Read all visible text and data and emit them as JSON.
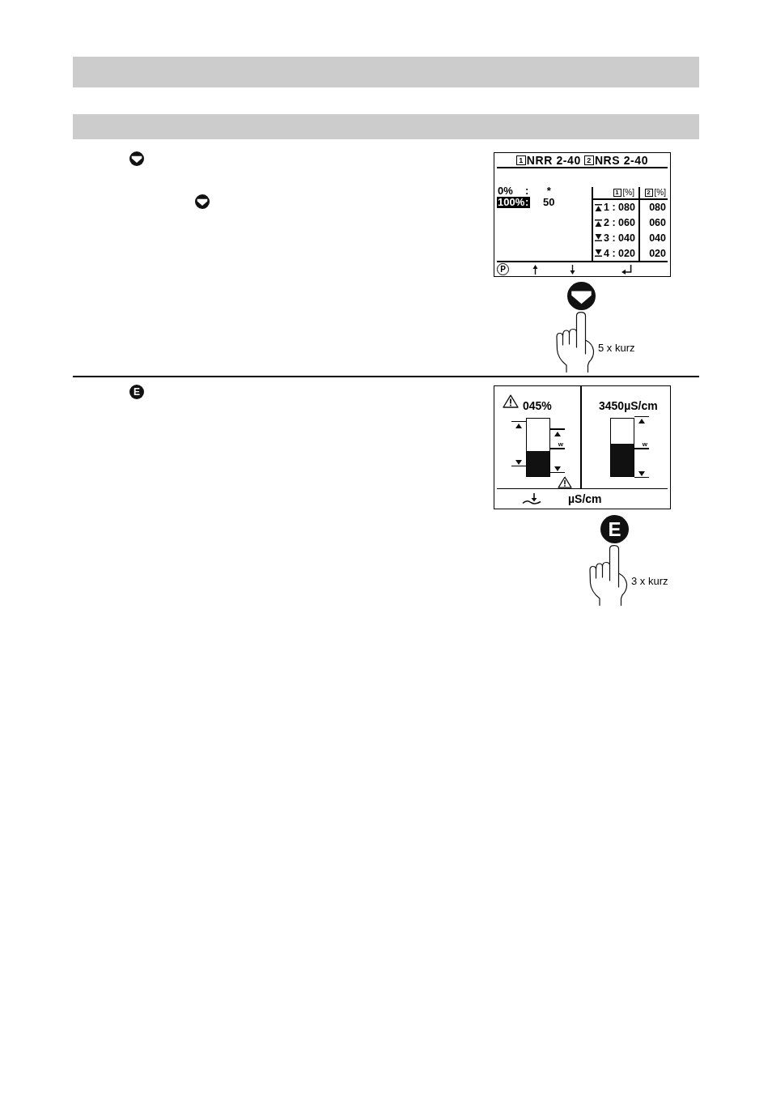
{
  "steps": [
    {
      "keys": [
        {
          "kind": "down"
        },
        {
          "kind": "down"
        }
      ],
      "display": {
        "kind": "scale",
        "title": [
          {
            "number": "1",
            "text": "NRR 2-40"
          },
          {
            "number": "2",
            "text": "NRS 2-40"
          }
        ],
        "scale": [
          {
            "label": "0%",
            "colon": ":",
            "value": "*",
            "selected": false
          },
          {
            "label": "100%",
            "colon": ":",
            "value": "50",
            "selected": true
          }
        ],
        "table": {
          "columns": [
            {
              "number": "1",
              "unit": "[%]"
            },
            {
              "number": "2",
              "unit": "[%]"
            }
          ],
          "rows": [
            {
              "kind": "up",
              "cells": [
                "1 : 080",
                "080"
              ]
            },
            {
              "kind": "up",
              "cells": [
                "2 : 060",
                "060"
              ]
            },
            {
              "kind": "down",
              "cells": [
                "3 : 040",
                "040"
              ]
            },
            {
              "kind": "down",
              "cells": [
                "4 : 020",
                "020"
              ]
            }
          ]
        },
        "softkeys": [
          {
            "kind": "letter",
            "label": "P"
          },
          {
            "kind": "up"
          },
          {
            "kind": "down"
          },
          {
            "kind": "enter"
          }
        ]
      },
      "press": {
        "key": {
          "kind": "down"
        },
        "note": "5 x kurz"
      }
    },
    {
      "keys": [
        {
          "kind": "letter",
          "label": "E"
        }
      ],
      "display": {
        "kind": "gauges",
        "panels": [
          {
            "alarm": true,
            "reading": "045%",
            "level": 0.44,
            "left_markers": [
              {
                "kind": "max",
                "level": 0.86
              },
              {
                "kind": "min",
                "level": 0.25
              }
            ],
            "right_markers": [
              {
                "kind": "max",
                "level": 0.73
              },
              {
                "kind": "setpoint",
                "label": "w",
                "level": 0.55
              },
              {
                "kind": "min",
                "level": 0.14
              }
            ]
          },
          {
            "alarm": false,
            "reading": "3450µS/cm",
            "level": 0.56,
            "right_markers": [
              {
                "kind": "max",
                "level": 0.94
              },
              {
                "kind": "setpoint",
                "label": "w",
                "level": 0.55
              },
              {
                "kind": "min",
                "level": 0.06
              }
            ]
          }
        ],
        "softkeys": [
          {
            "kind": "wave_down"
          },
          {
            "kind": "text",
            "label": "µS/cm"
          }
        ]
      },
      "press": {
        "key": {
          "kind": "letter",
          "label": "E"
        },
        "note": "3 x kurz"
      }
    }
  ]
}
